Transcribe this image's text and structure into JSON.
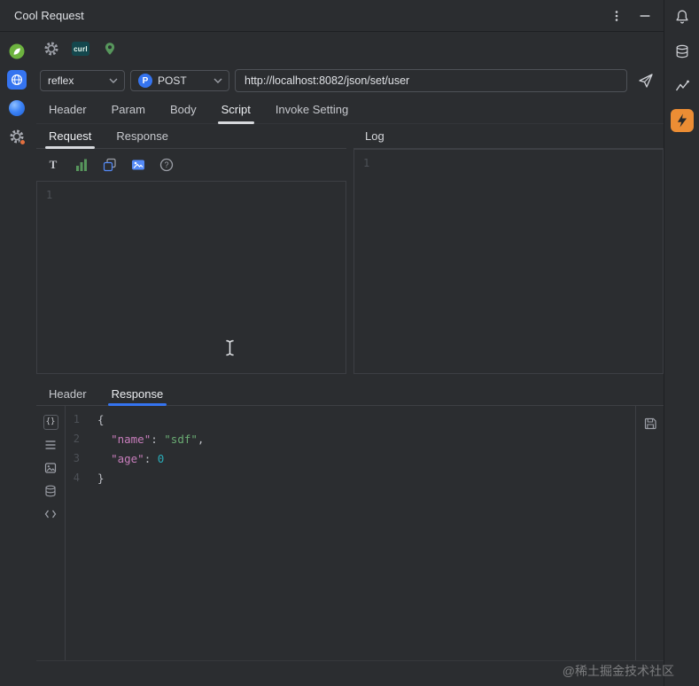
{
  "titlebar": {
    "title": "Cool Request"
  },
  "toolbar": {
    "curl_label": "curl"
  },
  "request_bar": {
    "env_value": "reflex",
    "method_badge": "P",
    "method_value": "POST",
    "url_value": "http://localhost:8082/json/set/user"
  },
  "main_tabs": [
    "Header",
    "Param",
    "Body",
    "Script",
    "Invoke Setting"
  ],
  "script_panel": {
    "tabs": [
      "Request",
      "Response"
    ],
    "first_line_number": "1"
  },
  "log_panel": {
    "title": "Log",
    "first_line_number": "1"
  },
  "bottom_panel": {
    "tabs": [
      "Header",
      "Response"
    ],
    "code_lines": [
      {
        "num": "1",
        "tokens": [
          {
            "t": "{",
            "c": "plain"
          }
        ]
      },
      {
        "num": "2",
        "tokens": [
          {
            "t": "  ",
            "c": "plain"
          },
          {
            "t": "\"name\"",
            "c": "key"
          },
          {
            "t": ": ",
            "c": "plain"
          },
          {
            "t": "\"sdf\"",
            "c": "string"
          },
          {
            "t": ",",
            "c": "plain"
          }
        ]
      },
      {
        "num": "3",
        "tokens": [
          {
            "t": "  ",
            "c": "plain"
          },
          {
            "t": "\"age\"",
            "c": "key"
          },
          {
            "t": ": ",
            "c": "plain"
          },
          {
            "t": "0",
            "c": "number"
          }
        ]
      },
      {
        "num": "4",
        "tokens": [
          {
            "t": "}",
            "c": "plain"
          }
        ]
      }
    ]
  },
  "watermark": "@稀土掘金技术社区",
  "colors": {
    "accent": "#3574f0",
    "spring-green": "#6db33f",
    "pin-green": "#57965c",
    "cool-orange": "#ec8d34",
    "syntax-key": "#c77dbb",
    "syntax-string": "#6aab73",
    "syntax-number": "#2aacb8"
  }
}
